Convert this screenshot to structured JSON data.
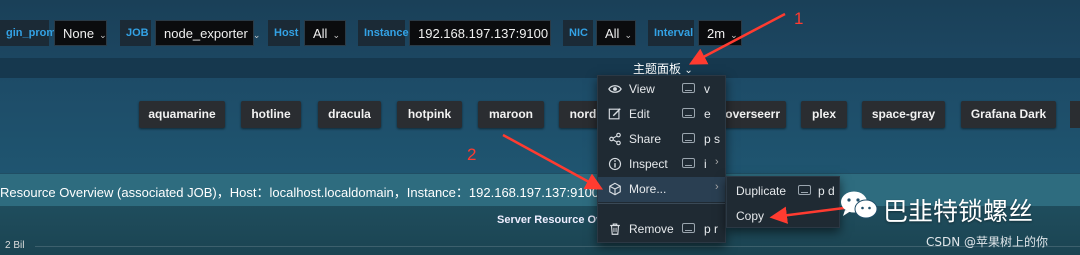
{
  "variables": [
    {
      "label": "gin_prom",
      "value": "None"
    },
    {
      "label": "JOB",
      "value": "node_exporter"
    },
    {
      "label": "Host",
      "value": "All"
    },
    {
      "label": "Instance",
      "value": "192.168.197.137:9100"
    },
    {
      "label": "NIC",
      "value": "All"
    },
    {
      "label": "Interval",
      "value": "2m"
    }
  ],
  "header": {
    "title": "主题面板",
    "chevron": "⌄"
  },
  "themes": [
    "aquamarine",
    "hotline",
    "dracula",
    "hotpink",
    "maroon",
    "nord",
    "overseerr",
    "plex",
    "space-gray",
    "Grafana Dark"
  ],
  "panel": {
    "header_text": "Resource Overview (associated JOB)，Host：localhost.localdomain，Instance：192.168.197.137:9100",
    "chart_title": "Server Resource Ov",
    "ytick": "2 Bil"
  },
  "menu": {
    "items": [
      {
        "label": "View",
        "shortcut": "v",
        "icon": "eye-icon"
      },
      {
        "label": "Edit",
        "shortcut": "e",
        "icon": "edit-icon"
      },
      {
        "label": "Share",
        "shortcut": "p s",
        "icon": "share-icon"
      },
      {
        "label": "Inspect",
        "shortcut": "i",
        "icon": "info-icon",
        "submenu": true
      },
      {
        "label": "More...",
        "shortcut": "",
        "icon": "cube-icon",
        "submenu": true,
        "active": true
      },
      {
        "label": "Remove",
        "shortcut": "p r",
        "icon": "trash-icon"
      }
    ]
  },
  "submenu": {
    "items": [
      {
        "label": "Duplicate",
        "shortcut": "p d"
      },
      {
        "label": "Copy",
        "shortcut": ""
      }
    ]
  },
  "annotations": {
    "step1": "1",
    "step2": "2"
  },
  "watermark": {
    "text": "巴韭特锁螺丝",
    "csdn": "CSDN @苹果树上的你",
    "icon": "wechat-bubble-icon"
  },
  "colors": {
    "accent": "#33a2e5",
    "annotation": "#ff3b30",
    "menu_bg": "#1f2a33"
  }
}
